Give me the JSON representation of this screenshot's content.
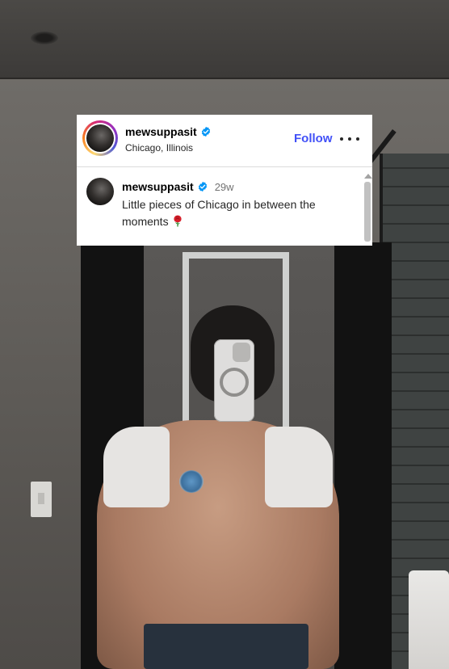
{
  "post": {
    "username": "mewsuppasit",
    "location": "Chicago, Illinois",
    "follow_label": "Follow",
    "more_label": "More options",
    "verified": true
  },
  "comment": {
    "username": "mewsuppasit",
    "time": "29w",
    "text": "Little pieces of Chicago in between the moments",
    "emoji": "rose-icon"
  },
  "colors": {
    "follow": "#4150f7",
    "verified": "#0095f6",
    "story_ring": [
      "#feda75",
      "#fa7e1e",
      "#d62976",
      "#962fbf",
      "#4f5bd5"
    ]
  },
  "photo": {
    "description_visible": false
  }
}
